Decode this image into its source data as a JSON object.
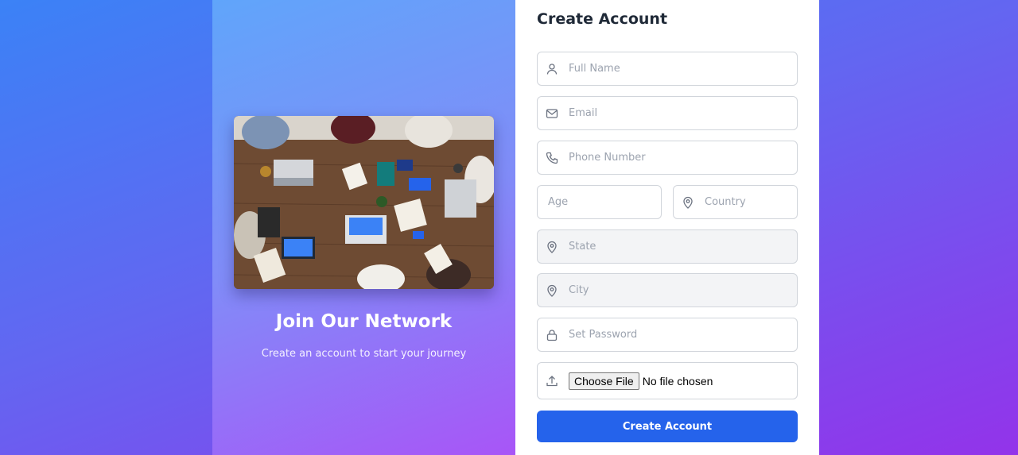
{
  "hero": {
    "title": "Join Our Network",
    "subtitle": "Create an account to start your journey",
    "image": "team-meeting-photo"
  },
  "form": {
    "title": "Create Account",
    "fields": {
      "full_name": {
        "placeholder": "Full Name",
        "icon": "user-icon",
        "value": ""
      },
      "email": {
        "placeholder": "Email",
        "icon": "mail-icon",
        "value": ""
      },
      "phone": {
        "placeholder": "Phone Number",
        "icon": "phone-icon",
        "value": ""
      },
      "age": {
        "placeholder": "Age",
        "value": ""
      },
      "country": {
        "placeholder": "Country",
        "icon": "map-pin-icon",
        "value": ""
      },
      "state": {
        "placeholder": "State",
        "icon": "map-pin-icon",
        "value": "",
        "disabled": true
      },
      "city": {
        "placeholder": "City",
        "icon": "map-pin-icon",
        "value": "",
        "disabled": true
      },
      "password": {
        "placeholder": "Set Password",
        "icon": "lock-icon",
        "value": ""
      },
      "file": {
        "button_label": "Choose File",
        "status": "No file chosen",
        "icon": "upload-icon"
      }
    },
    "submit_label": "Create Account"
  },
  "colors": {
    "accent": "#2563eb",
    "background_start": "#3b82f6",
    "background_end": "#9333ea"
  }
}
